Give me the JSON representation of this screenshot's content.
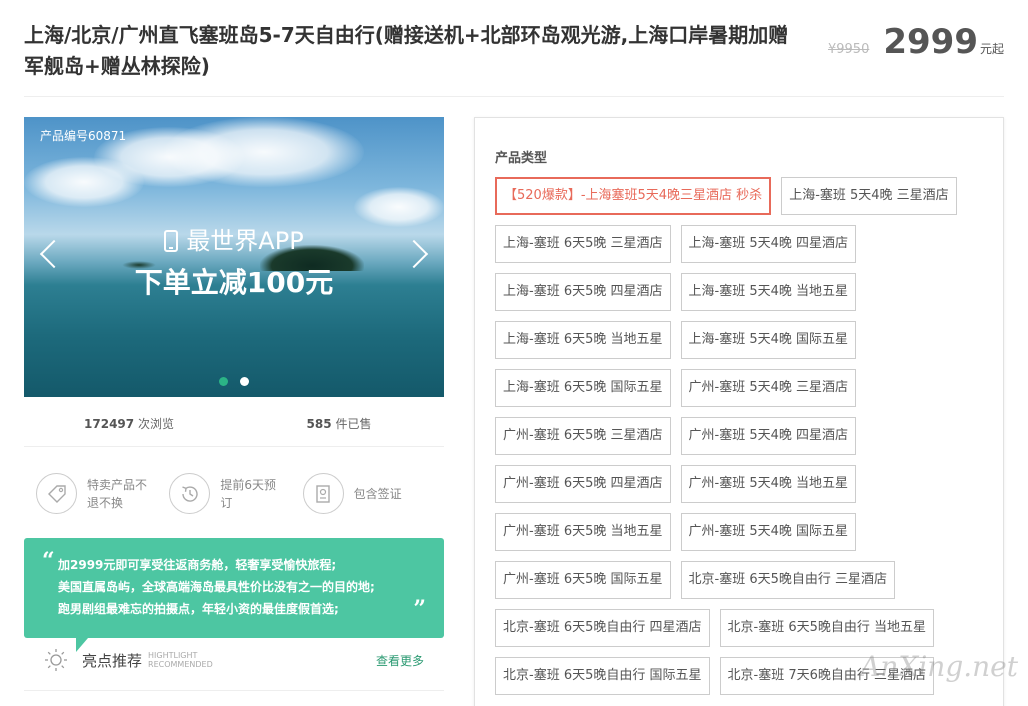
{
  "header": {
    "title": "上海/北京/广州直飞塞班岛5-7天自由行(赠接送机+北部环岛观光游,上海口岸暑期加赠军舰岛+赠丛林探险)",
    "old_price": "¥9950",
    "price": "2999",
    "price_unit": "元起"
  },
  "banner": {
    "product_no": "产品编号60871",
    "app_line": "最世界APP",
    "discount": "下单立减100元",
    "slides": 2,
    "active_slide": 1
  },
  "stats": {
    "views": "172497",
    "views_label": "次浏览",
    "sold": "585",
    "sold_label": "件已售"
  },
  "features": [
    {
      "icon": "tag-icon",
      "text": "特卖产品不退不换"
    },
    {
      "icon": "clock-history-icon",
      "text": "提前6天预订"
    },
    {
      "icon": "passport-icon",
      "text": "包含签证"
    }
  ],
  "quote": {
    "line1": "加2999元即可享受往返商务舱，轻奢享受愉快旅程;",
    "line2": "美国直属岛屿，全球高端海岛最具性价比没有之一的目的地;",
    "line3": "跑男剧组最难忘的拍摄点，年轻小资的最佳度假首选;"
  },
  "highlight": {
    "title": "亮点推荐",
    "en1": "HIGHTLIGHT",
    "en2": "RECOMMENDED",
    "more": "查看更多"
  },
  "panel": {
    "label": "产品类型",
    "options": [
      "【520爆款】-上海塞班5天4晚三星酒店 秒杀",
      "上海-塞班 5天4晚 三星酒店",
      "上海-塞班 6天5晚 三星酒店",
      "上海-塞班 5天4晚 四星酒店",
      "上海-塞班 6天5晚 四星酒店",
      "上海-塞班 5天4晚 当地五星",
      "上海-塞班 6天5晚 当地五星",
      "上海-塞班 5天4晚 国际五星",
      "上海-塞班 6天5晚 国际五星",
      "广州-塞班 5天4晚 三星酒店",
      "广州-塞班 6天5晚 三星酒店",
      "广州-塞班 5天4晚 四星酒店",
      "广州-塞班 6天5晚 四星酒店",
      "广州-塞班 5天4晚 当地五星",
      "广州-塞班 6天5晚 当地五星",
      "广州-塞班 5天4晚 国际五星",
      "广州-塞班 6天5晚 国际五星",
      "北京-塞班 6天5晚自由行 三星酒店",
      "北京-塞班 6天5晚自由行 四星酒店",
      "北京-塞班 6天5晚自由行 当地五星",
      "北京-塞班 6天5晚自由行 国际五星",
      "北京-塞班 7天6晚自由行 三星酒店"
    ],
    "selected_index": 0
  },
  "watermark": "AnXing.net",
  "colors": {
    "accent_green": "#4dc6a2",
    "selected_red": "#e86a5a",
    "link_green": "#2b9a72"
  }
}
